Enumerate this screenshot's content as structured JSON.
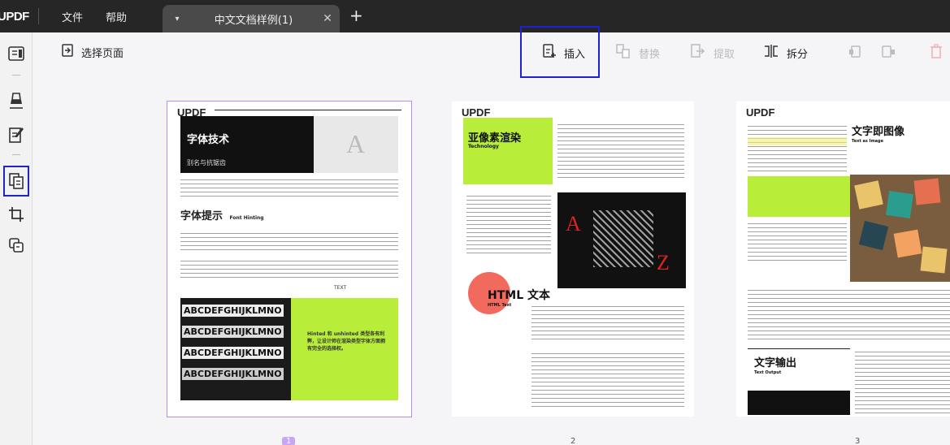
{
  "titlebar": {
    "logo": "UPDF",
    "menu": [
      "文件",
      "帮助"
    ],
    "tab_title": "中文文档样例(1)",
    "tab_close": "✕",
    "new_tab": "+"
  },
  "toolbar": {
    "select_pages": "选择页面",
    "insert": "插入",
    "replace": "替换",
    "extract": "提取",
    "split": "拆分"
  },
  "pages": [
    {
      "number": "1",
      "badge": "UPDF",
      "hero_title": "字体技术",
      "hero_sub": "别名与抗锯齿",
      "section_title": "字体提示",
      "section_sub": "Font Hinting",
      "text_label": "TEXT",
      "letters_row": "ABCDEFGHIJKLMNO",
      "green_box_text": "Hinted 和 unhinted 类型各有利弊，让设计师在渲染类型字体方面拥有完全的选择权。"
    },
    {
      "number": "2",
      "badge": "UPDF",
      "hero_title": "亚像素渲染",
      "hero_sub": "Technology",
      "html_title": "HTML 文本",
      "html_sub": "HTML Text"
    },
    {
      "number": "3",
      "badge": "UPDF",
      "text_to_image": "文字即图像",
      "text_as_image": "Text as Image",
      "text_output": "文字输出",
      "text_output_sub": "Text Output"
    }
  ]
}
